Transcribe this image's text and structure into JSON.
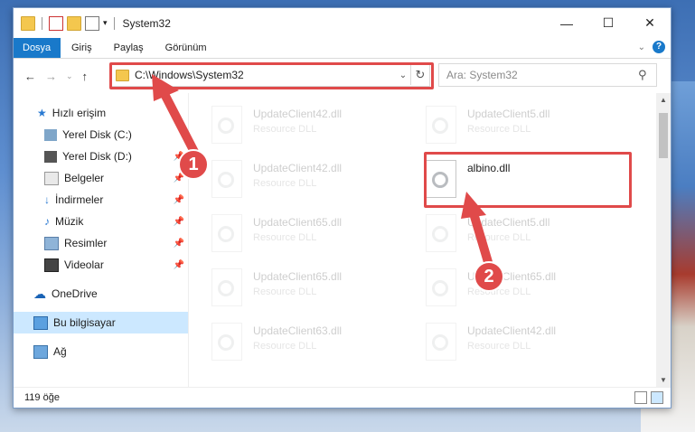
{
  "window": {
    "title": "System32"
  },
  "ribbon": {
    "tabs": [
      "Dosya",
      "Giriş",
      "Paylaş",
      "Görünüm"
    ]
  },
  "address": {
    "path": "C:\\Windows\\System32"
  },
  "search": {
    "placeholder": "Ara: System32"
  },
  "sidebar": {
    "quick_access": "Hızlı erişim",
    "items": [
      {
        "label": "Yerel Disk (C:)",
        "pinned": false
      },
      {
        "label": "Yerel Disk (D:)",
        "pinned": true
      },
      {
        "label": "Belgeler",
        "pinned": true
      },
      {
        "label": "İndirmeler",
        "pinned": true
      },
      {
        "label": "Müzik",
        "pinned": true
      },
      {
        "label": "Resimler",
        "pinned": true
      },
      {
        "label": "Videolar",
        "pinned": true
      }
    ],
    "onedrive": "OneDrive",
    "this_pc": "Bu bilgisayar",
    "network": "Ağ"
  },
  "files": [
    {
      "name": "UpdateClient42.dll",
      "type": "Resource DLL"
    },
    {
      "name": "UpdateClient5.dll",
      "type": "Resource DLL"
    },
    {
      "name": "UpdateClient42.dll",
      "type": "Resource DLL"
    },
    {
      "name": "albino.dll",
      "type": ""
    },
    {
      "name": "UpdateClient65.dll",
      "type": "Resource DLL"
    },
    {
      "name": "UpdateClient5.dll",
      "type": "Resource DLL"
    },
    {
      "name": "UpdateClient65.dll",
      "type": "Resource DLL"
    },
    {
      "name": "UpdateClient65.dll",
      "type": "Resource DLL"
    },
    {
      "name": "UpdateClient63.dll",
      "type": "Resource DLL"
    },
    {
      "name": "UpdateClient42.dll",
      "type": "Resource DLL"
    }
  ],
  "status": {
    "count": "119 öğe"
  },
  "callouts": [
    "1",
    "2"
  ],
  "colors": {
    "accent": "#1979ca",
    "highlight": "#e04a4a"
  }
}
